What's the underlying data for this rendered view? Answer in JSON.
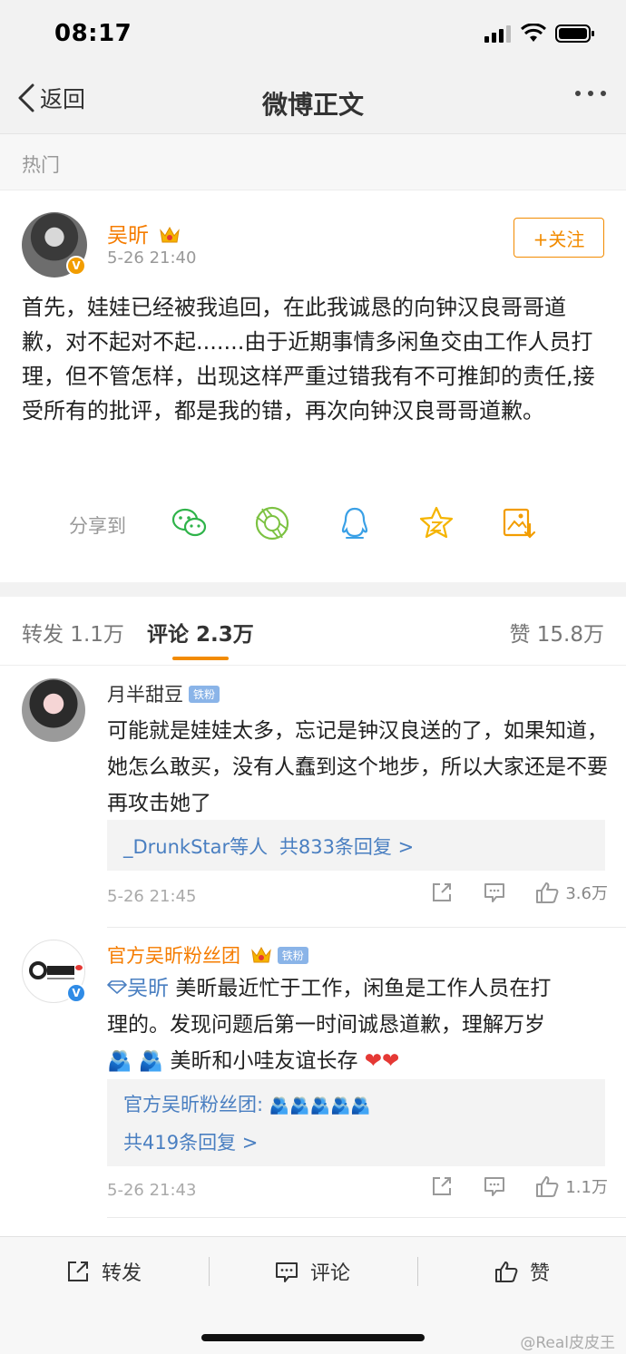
{
  "status_bar": {
    "time": "08:17"
  },
  "nav": {
    "back_label": "返回",
    "title": "微博正文"
  },
  "section_label": "热门",
  "post": {
    "author": "吴昕",
    "time": "5-26 21:40",
    "follow_label": "+关注",
    "text": "首先，娃娃已经被我追回，在此我诚恳的向钟汉良哥哥道歉，对不起对不起.......由于近期事情多闲鱼交由工作人员打理，但不管怎样，出现这样严重过错我有不可推卸的责任,接受所有的批评，都是我的错，再次向钟汉良哥哥道歉。",
    "share_label": "分享到",
    "share_icons": [
      "wechat-icon",
      "moments-icon",
      "qq-icon",
      "favorite-icon",
      "save-image-icon"
    ]
  },
  "tabs": {
    "repost": "转发 1.1万",
    "comment": "评论 2.3万",
    "like": "赞 15.8万"
  },
  "comments": [
    {
      "author": "月半甜豆",
      "tag": "铁粉",
      "text": "可能就是娃娃太多，忘记是钟汉良送的了，如果知道，她怎么敢买，没有人蠢到这个地步，所以大家还是不要再攻击她了",
      "reply_names": "_DrunkStar等人",
      "reply_count": "共833条回复 >",
      "time": "5-26 21:45",
      "likes": "3.6万"
    },
    {
      "author": "官方吴昕粉丝团",
      "tag": "铁粉",
      "mention": "吴昕",
      "text_line1": "美昕最近忙于工作，闲鱼是工作人员在打",
      "text_line2": "理的。发现问题后第一时间诚恳道歉，理解万岁",
      "text_line3": "美昕和小哇友谊长存",
      "reply_author": "官方吴昕粉丝团:",
      "reply_count": "共419条回复 >",
      "time": "5-26 21:43",
      "likes": "1.1万"
    }
  ],
  "bottom_bar": {
    "repost": "转发",
    "comment": "评论",
    "like": "赞"
  },
  "watermark": "@Real皮皮王",
  "colors": {
    "accent": "#f28b00",
    "link": "#4a7fc1",
    "name_orange": "#f57c00"
  }
}
